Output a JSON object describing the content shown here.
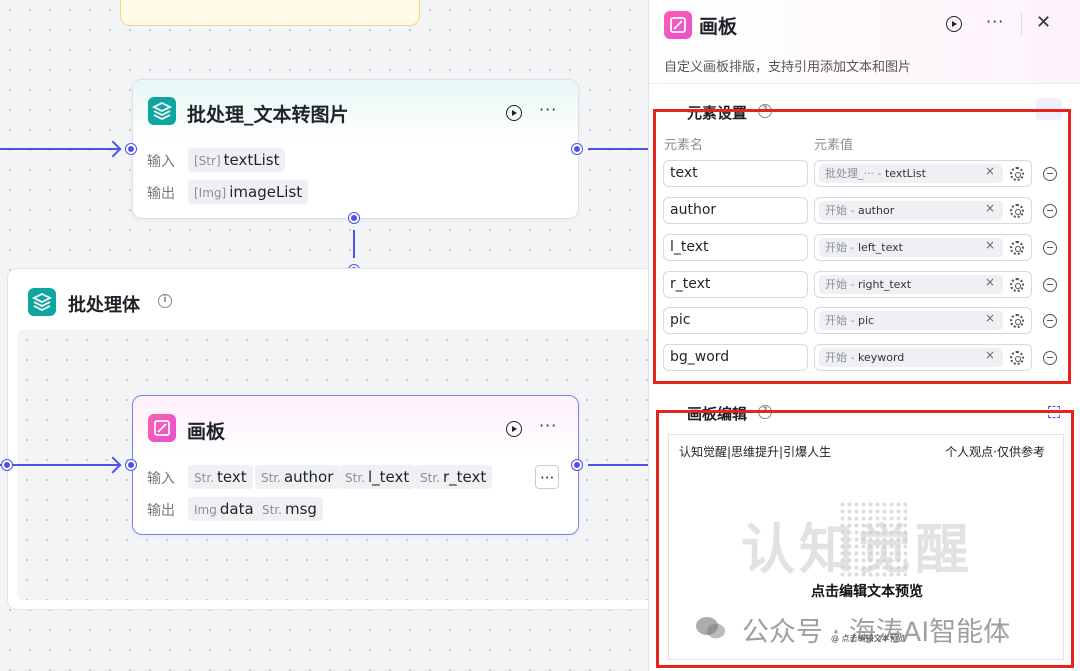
{
  "canvas": {
    "batch_node": {
      "title": "批处理_文本转图片",
      "input_label": "输入",
      "output_label": "输出",
      "input_tag": {
        "type": "[Str]",
        "name": "textList"
      },
      "output_tag": {
        "type": "[Img]",
        "name": "imageList"
      }
    },
    "group": {
      "title": "批处理体"
    },
    "board_node": {
      "title": "画板",
      "input_label": "输入",
      "output_label": "输出",
      "inputs": [
        {
          "type": "Str.",
          "name": "text"
        },
        {
          "type": "Str.",
          "name": "author"
        },
        {
          "type": "Str.",
          "name": "l_text"
        },
        {
          "type": "Str.",
          "name": "r_text"
        }
      ],
      "outputs": [
        {
          "type": "Img",
          "name": "data"
        },
        {
          "type": "Str.",
          "name": "msg"
        }
      ]
    },
    "more_symbol": "···"
  },
  "panel": {
    "title": "画板",
    "description": "自定义画板排版，支持引用添加文本和图片",
    "close_symbol": "✕",
    "more_symbol": "···",
    "elements_section": {
      "title": "元素设置",
      "col_name": "元素名",
      "col_value": "元素值",
      "rows": [
        {
          "name": "text",
          "source": "批处理_···",
          "value": "textList"
        },
        {
          "name": "author",
          "source": "开始",
          "value": "author"
        },
        {
          "name": "l_text",
          "source": "开始",
          "value": "left_text"
        },
        {
          "name": "r_text",
          "source": "开始",
          "value": "right_text"
        },
        {
          "name": "pic",
          "source": "开始",
          "value": "pic"
        },
        {
          "name": "bg_word",
          "source": "开始",
          "value": "keyword"
        }
      ],
      "remove_symbol": "×"
    },
    "editor_section": {
      "title": "画板编辑",
      "preview": {
        "top_left": "认知觉醒|思维提升|引爆人生",
        "top_right": "个人观点·仅供参考",
        "bg_word": "认知觉醒",
        "hint": "点击编辑文本预览",
        "footer": "@  点击编辑文本预览"
      }
    }
  },
  "watermark": "公众号 · 海涛AI智能体",
  "colors": {
    "accent": "#4d53e8",
    "highlight": "#e8221c",
    "teal": "#0fa5a0",
    "pink": "#ff5fae"
  }
}
